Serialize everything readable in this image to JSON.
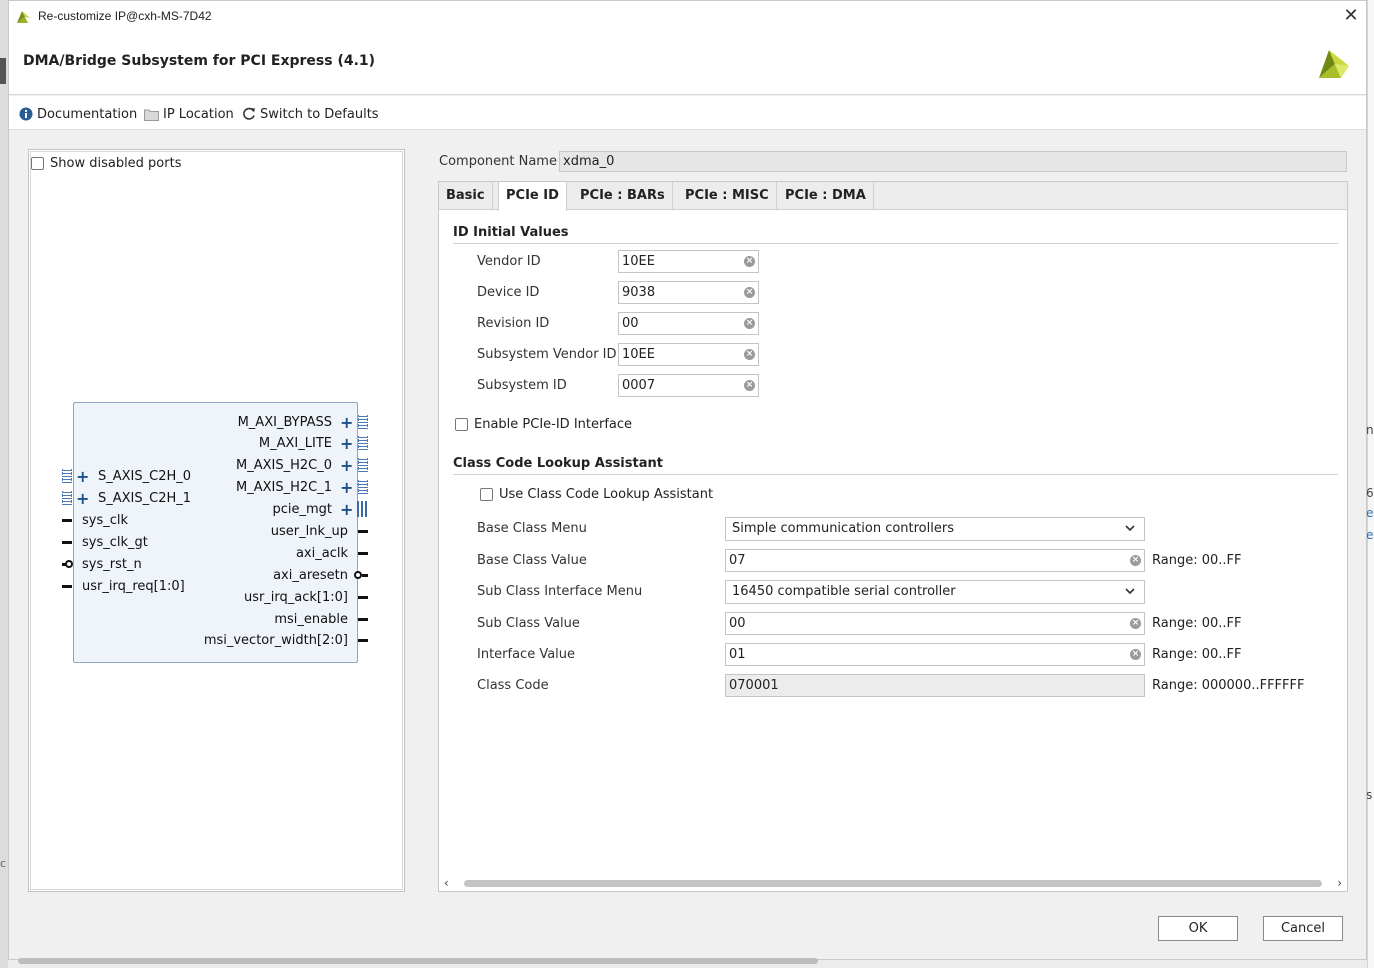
{
  "window": {
    "title": "Re-customize IP@cxh-MS-7D42",
    "close_glyph": "✕"
  },
  "header": {
    "ip_title": "DMA/Bridge Subsystem for PCI Express (4.1)",
    "logo_icon": "xilinx-logo-icon"
  },
  "toolbar": {
    "documentation": "Documentation",
    "ip_location": "IP Location",
    "switch_defaults": "Switch to Defaults"
  },
  "left_panel": {
    "show_disabled_ports": "Show disabled ports",
    "show_disabled_checked": false
  },
  "ip_block": {
    "left_ports": [
      {
        "name": "S_AXIS_C2H_0",
        "kind": "bus"
      },
      {
        "name": "S_AXIS_C2H_1",
        "kind": "bus"
      },
      {
        "name": "sys_clk",
        "kind": "wire"
      },
      {
        "name": "sys_clk_gt",
        "kind": "wire"
      },
      {
        "name": "sys_rst_n",
        "kind": "inverted"
      },
      {
        "name": "usr_irq_req[1:0]",
        "kind": "wire"
      }
    ],
    "right_ports": [
      {
        "name": "M_AXI_BYPASS",
        "kind": "bus"
      },
      {
        "name": "M_AXI_LITE",
        "kind": "bus"
      },
      {
        "name": "M_AXIS_H2C_0",
        "kind": "bus"
      },
      {
        "name": "M_AXIS_H2C_1",
        "kind": "bus"
      },
      {
        "name": "pcie_mgt",
        "kind": "mgt"
      },
      {
        "name": "user_lnk_up",
        "kind": "wire"
      },
      {
        "name": "axi_aclk",
        "kind": "wire"
      },
      {
        "name": "axi_aresetn",
        "kind": "inverted"
      },
      {
        "name": "usr_irq_ack[1:0]",
        "kind": "wire"
      },
      {
        "name": "msi_enable",
        "kind": "wire"
      },
      {
        "name": "msi_vector_width[2:0]",
        "kind": "wire"
      }
    ]
  },
  "component": {
    "label": "Component Name",
    "value": "xdma_0"
  },
  "tabs": [
    {
      "label": "Basic",
      "active": false
    },
    {
      "label": "PCIe ID",
      "active": true
    },
    {
      "label": "PCIe : BARs",
      "active": false
    },
    {
      "label": "PCIe : MISC",
      "active": false
    },
    {
      "label": "PCIe : DMA",
      "active": false
    }
  ],
  "id_initial": {
    "title": "ID Initial Values",
    "fields": [
      {
        "label": "Vendor ID",
        "value": "10EE"
      },
      {
        "label": "Device ID",
        "value": "9038"
      },
      {
        "label": "Revision ID",
        "value": "00"
      },
      {
        "label": "Subsystem Vendor ID",
        "value": "10EE"
      },
      {
        "label": "Subsystem ID",
        "value": "0007"
      }
    ],
    "enable_pcie_id": "Enable PCIe-ID Interface",
    "enable_pcie_id_checked": false
  },
  "class_code": {
    "title": "Class Code Lookup Assistant",
    "use_assistant": "Use Class Code Lookup Assistant",
    "use_assistant_checked": false,
    "base_class_menu_label": "Base Class Menu",
    "base_class_menu_value": "Simple communication controllers",
    "base_class_value_label": "Base Class Value",
    "base_class_value": "07",
    "base_class_range": "Range: 00..FF",
    "sub_class_menu_label": "Sub Class Interface Menu",
    "sub_class_menu_value": "16450 compatible serial controller",
    "sub_class_value_label": "Sub Class Value",
    "sub_class_value": "00",
    "sub_class_range": "Range: 00..FF",
    "interface_value_label": "Interface Value",
    "interface_value": "01",
    "interface_range": "Range: 00..FF",
    "class_code_label": "Class Code",
    "class_code_value": "070001",
    "class_code_range": "Range: 000000..FFFFFF"
  },
  "buttons": {
    "ok": "OK",
    "cancel": "Cancel"
  },
  "background_fragments": {
    "n": "n",
    "six": "6-",
    "e1": "e",
    "e2": "e",
    "s": "s",
    "c": "c"
  }
}
